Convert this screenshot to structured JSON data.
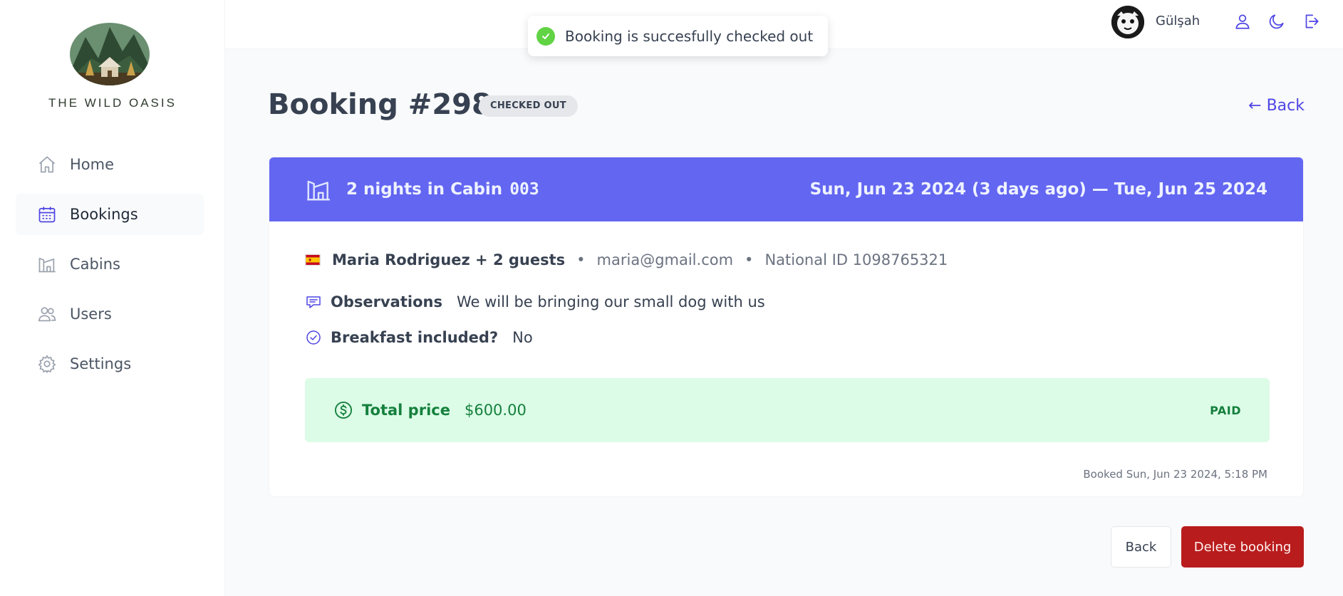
{
  "brand": {
    "name": "THE WILD OASIS"
  },
  "sidebar": {
    "items": [
      {
        "label": "Home",
        "icon": "home-icon"
      },
      {
        "label": "Bookings",
        "icon": "calendar-icon"
      },
      {
        "label": "Cabins",
        "icon": "cabin-icon"
      },
      {
        "label": "Users",
        "icon": "users-icon"
      },
      {
        "label": "Settings",
        "icon": "gear-icon"
      }
    ],
    "active": "Bookings"
  },
  "header": {
    "user_name": "Gülşah",
    "icons": [
      "user-icon",
      "moon-icon",
      "logout-icon"
    ]
  },
  "toast": {
    "message": "Booking is succesfully checked out",
    "status": "success"
  },
  "page": {
    "title": "Booking #298",
    "status": "CHECKED OUT",
    "back_link": "← Back"
  },
  "booking": {
    "nights_text": "2 nights in Cabin",
    "cabin": "003",
    "dates": "Sun, Jun 23 2024 (3 days ago) — Tue, Jun 25 2024",
    "guest": "Maria Rodriguez + 2 guests",
    "email": "maria@gmail.com",
    "national_id": "National ID 1098765321",
    "separator": "•",
    "observations_label": "Observations",
    "observations": "We will be bringing our small dog with us",
    "breakfast_label": "Breakfast included?",
    "breakfast": "No",
    "price_label": "Total price",
    "price": "$600.00",
    "payment_status": "PAID",
    "booked_at": "Booked Sun, Jun 23 2024, 5:18 PM"
  },
  "actions": {
    "back": "Back",
    "delete": "Delete booking"
  },
  "colors": {
    "accent": "#6366f1",
    "link": "#4f46e5",
    "paid_bg": "#dcfce7",
    "paid_text": "#15803d",
    "danger": "#b91c1c"
  }
}
